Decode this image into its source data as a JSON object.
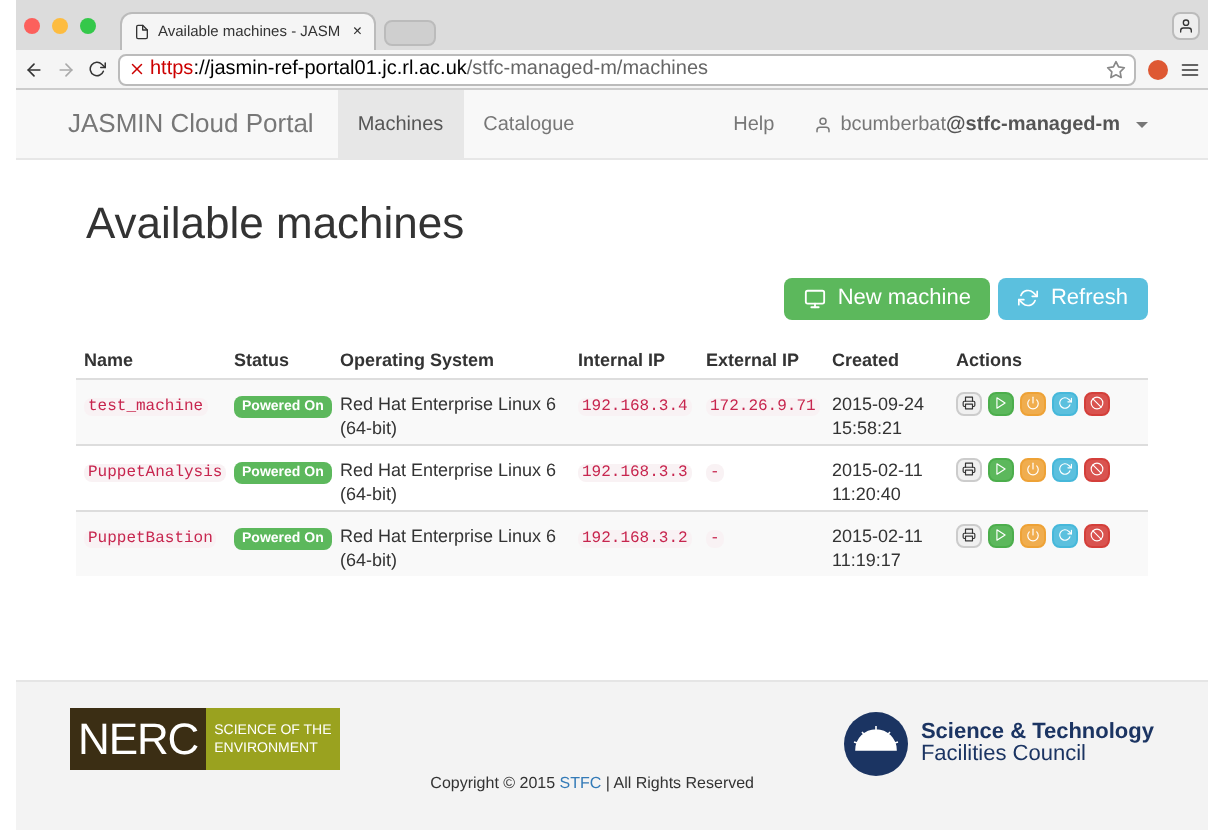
{
  "browser": {
    "tab_title": "Available machines - JASM",
    "tab_close": "×",
    "url_scheme": "https",
    "url_host": "://jasmin-ref-portal01.jc.rl.ac.uk",
    "url_path": "/stfc-managed-m/machines"
  },
  "navbar": {
    "brand": "JASMIN Cloud Portal",
    "items": [
      {
        "label": "Machines",
        "selected": true
      },
      {
        "label": "Catalogue",
        "selected": false
      }
    ],
    "help": "Help",
    "user": "bcumberbat",
    "tenant": "@stfc-managed-m"
  },
  "page": {
    "title": "Available machines",
    "buttons": [
      {
        "label": "New machine",
        "kind": "new"
      },
      {
        "label": "Refresh",
        "kind": "refresh"
      }
    ]
  },
  "table": {
    "columns": [
      "Name",
      "Status",
      "Operating System",
      "Internal IP",
      "External IP",
      "Created",
      "Actions"
    ],
    "rows": [
      {
        "name": "test_machine",
        "status": "Powered On",
        "os": "Red Hat Enterprise Linux 6 (64-bit)",
        "internal_ip": "192.168.3.4",
        "external_ip": "172.26.9.71",
        "created_date": "2015-09-24",
        "created_time": "15:58:21"
      },
      {
        "name": "PuppetAnalysis",
        "status": "Powered On",
        "os": "Red Hat Enterprise Linux 6 (64-bit)",
        "internal_ip": "192.168.3.3",
        "external_ip": "-",
        "created_date": "2015-02-11",
        "created_time": "11:20:40"
      },
      {
        "name": "PuppetBastion",
        "status": "Powered On",
        "os": "Red Hat Enterprise Linux 6 (64-bit)",
        "internal_ip": "192.168.3.2",
        "external_ip": "-",
        "created_date": "2015-02-11",
        "created_time": "11:19:17"
      }
    ]
  },
  "footer": {
    "nerc_mark": "NERC",
    "nerc_line1": "SCIENCE OF THE",
    "nerc_line2": "ENVIRONMENT",
    "copyright_before": "Copyright © 2015 ",
    "copyright_link": "STFC",
    "copyright_after": " | All Rights Reserved",
    "stfc_line1": "Science & Technology",
    "stfc_line2": "Facilities Council"
  }
}
